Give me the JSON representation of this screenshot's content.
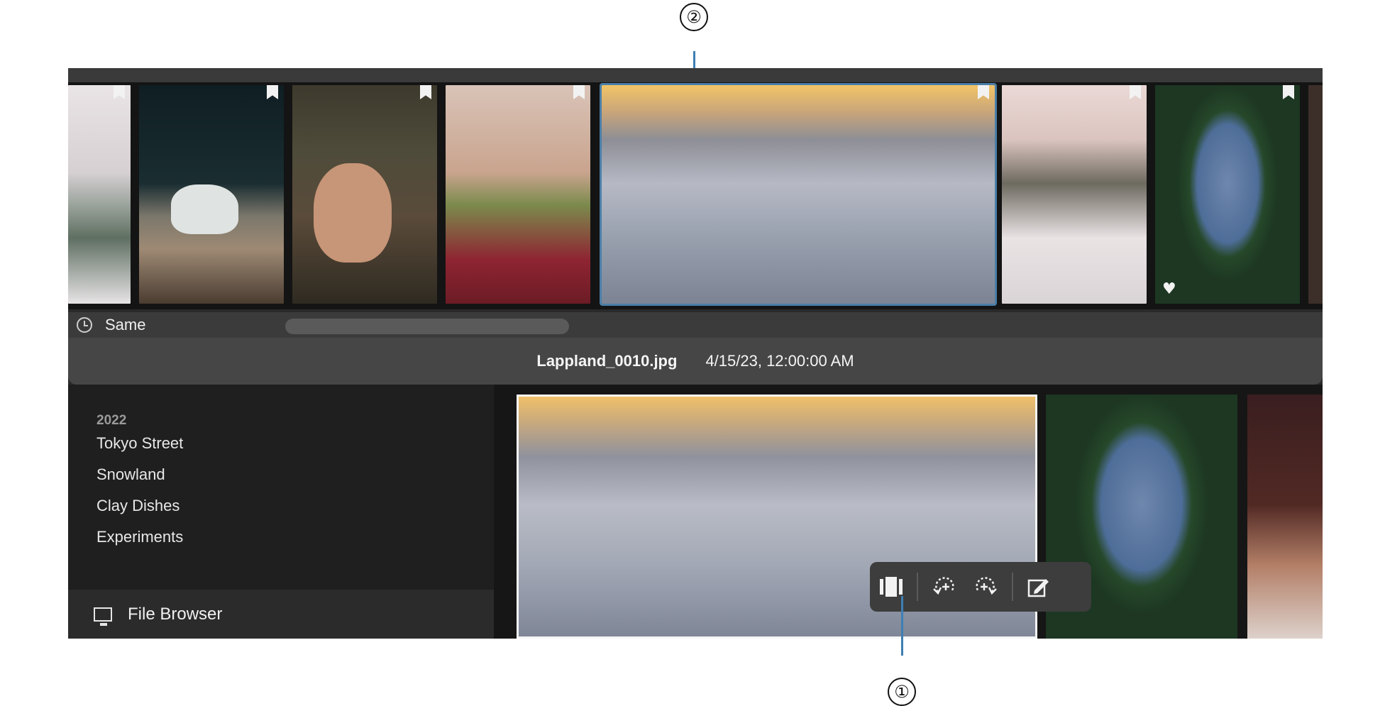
{
  "callouts": {
    "first": "①",
    "second": "②"
  },
  "filmstrip": {
    "thumbnails": [
      {
        "name": "snowy-road",
        "bookmarked": true
      },
      {
        "name": "white-cow-forest",
        "bookmarked": true
      },
      {
        "name": "cow-closeup",
        "bookmarked": true
      },
      {
        "name": "mug-sweater",
        "bookmarked": true
      },
      {
        "name": "aerial-town",
        "bookmarked": true,
        "selected": true
      },
      {
        "name": "snowy-trees-bridge",
        "bookmarked": true
      },
      {
        "name": "frozen-lake-aerial",
        "bookmarked": true,
        "favorite": true
      }
    ]
  },
  "timeline": {
    "sort_label": "Same"
  },
  "info": {
    "filename": "Lappland_0010.jpg",
    "datetime": "4/15/23, 12:00:00 AM"
  },
  "sidebar": {
    "year": "2022",
    "albums": [
      "Tokyo Street",
      "Snowland",
      "Clay Dishes",
      "Experiments"
    ],
    "file_browser_label": "File Browser"
  },
  "toolbar": {
    "buttons": [
      "compare-icon",
      "rotate-left-icon",
      "rotate-right-icon",
      "edit-icon"
    ]
  },
  "colors": {
    "accent": "#4a7ea8",
    "callout_line": "#3d7fb3",
    "app_bg": "#2a2a2a",
    "filmstrip_bg": "#141414",
    "infobar_bg": "#464646",
    "sidebar_bg": "#1f1f1f"
  }
}
